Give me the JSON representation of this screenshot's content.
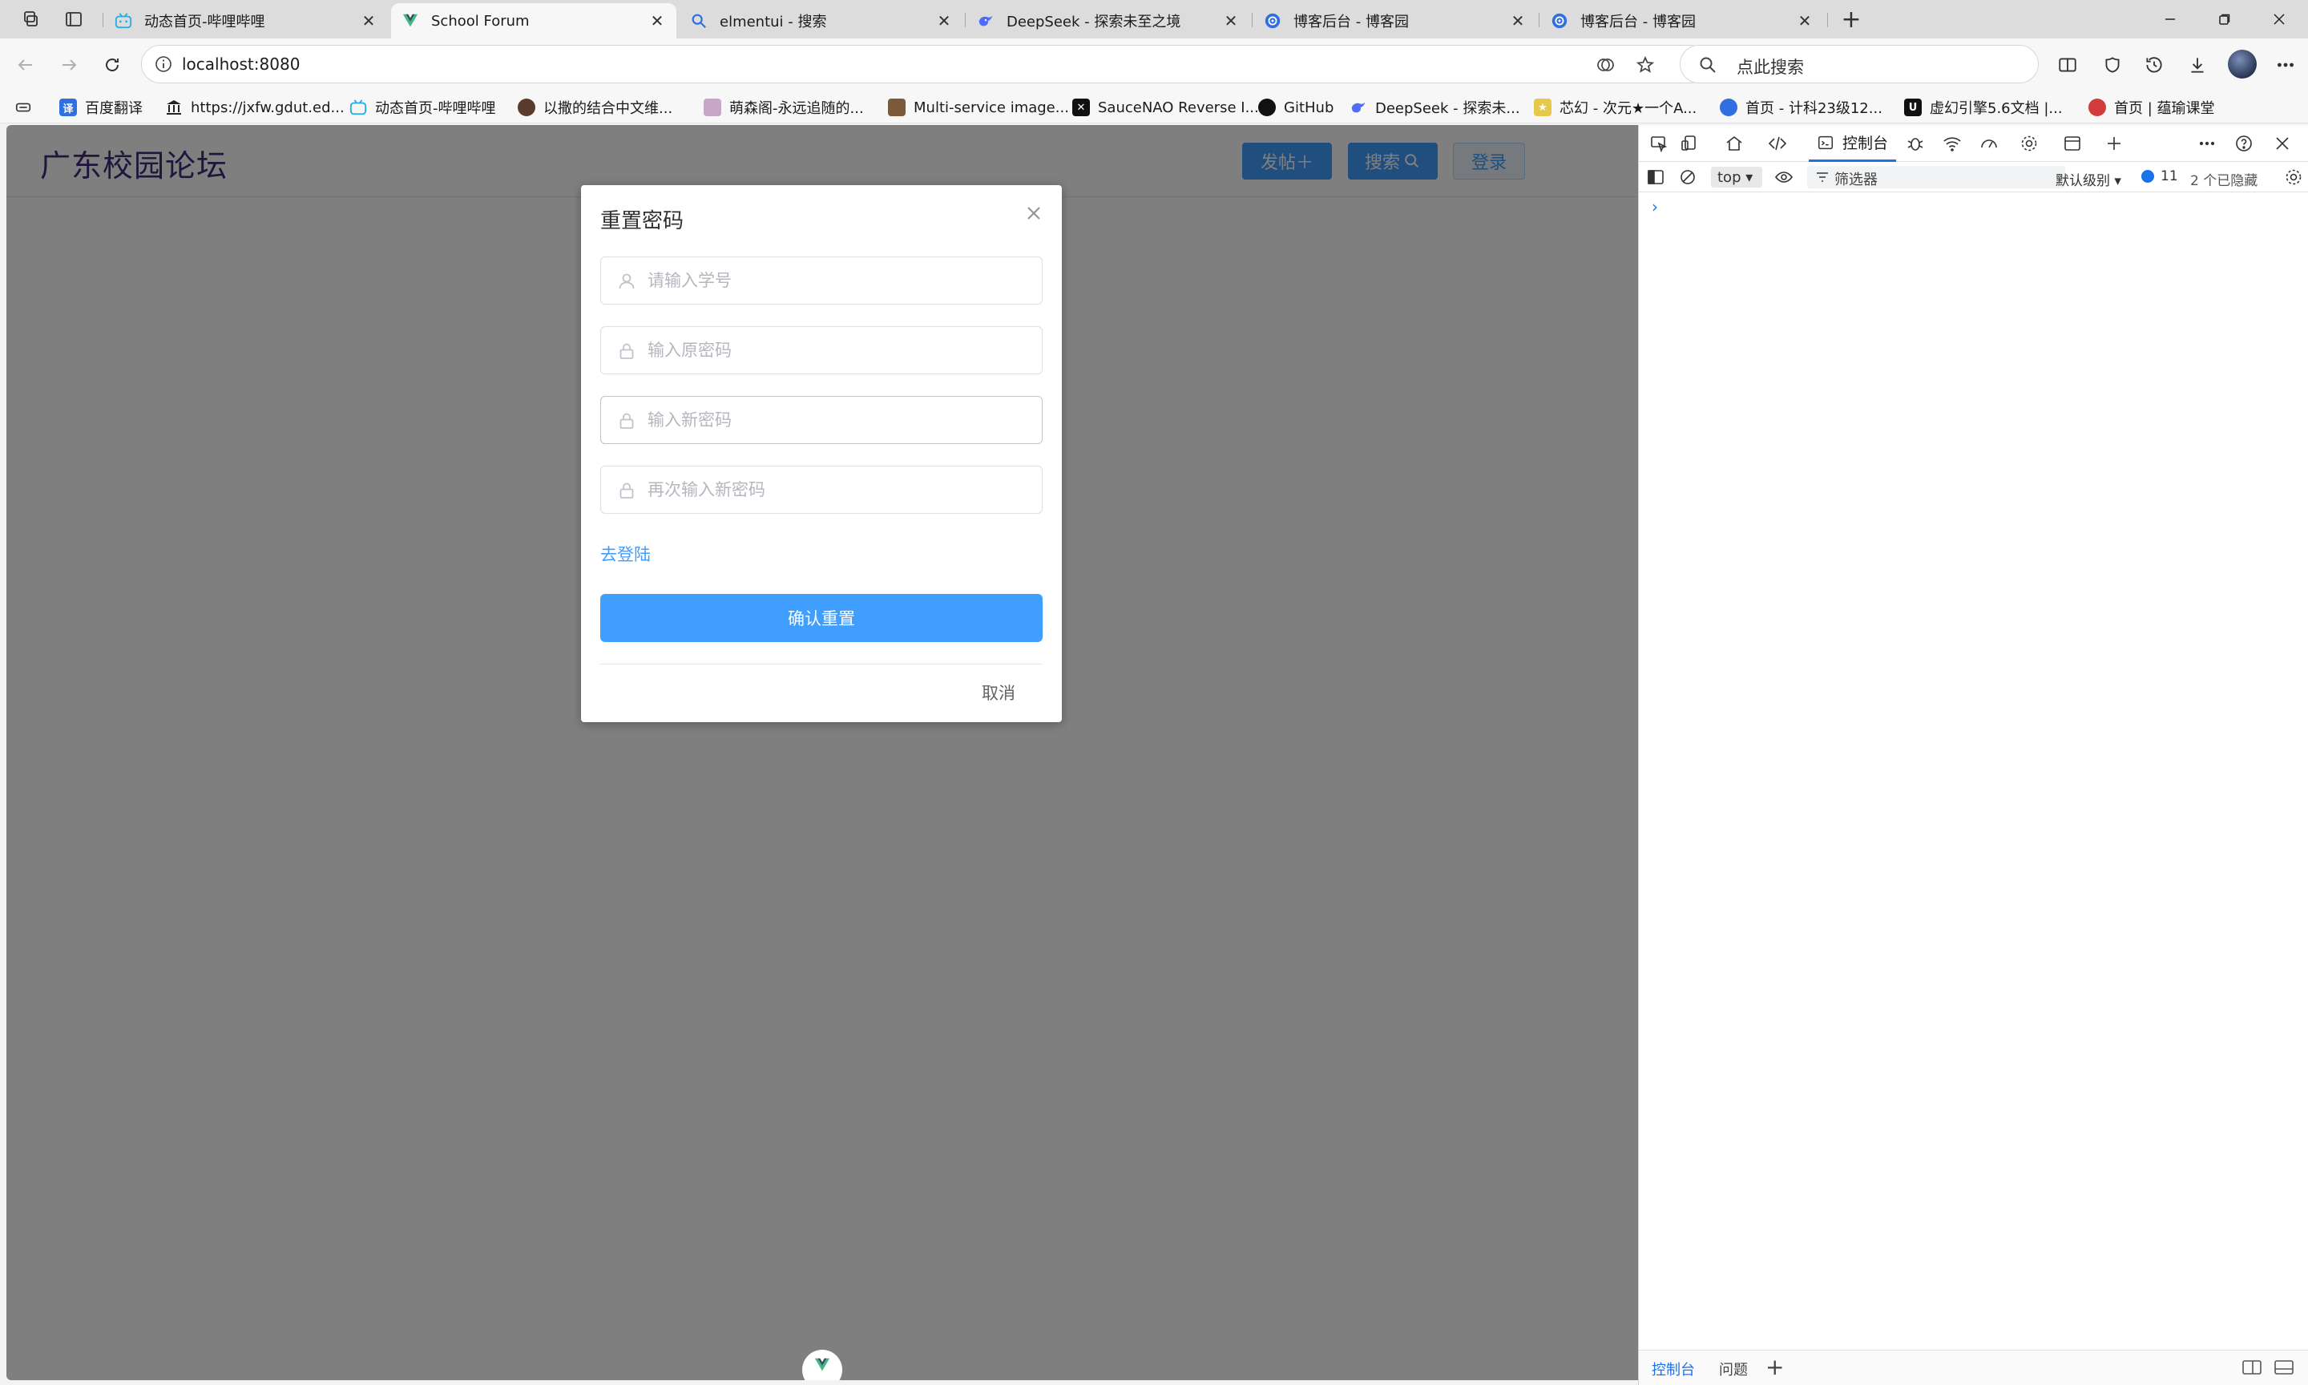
{
  "browser": {
    "tabs": [
      {
        "title": "动态首页-哔哩哔哩",
        "icon": "bilibili-icon",
        "active": false
      },
      {
        "title": "School Forum",
        "icon": "vue-icon",
        "active": true
      },
      {
        "title": "elmentui - 搜索",
        "icon": "search-icon",
        "active": false
      },
      {
        "title": "DeepSeek - 探索未至之境",
        "icon": "deepseek-icon",
        "active": false
      },
      {
        "title": "博客后台 - 博客园",
        "icon": "cnblogs-icon",
        "active": false
      },
      {
        "title": "博客后台 - 博客园",
        "icon": "cnblogs-icon",
        "active": false
      }
    ],
    "close_glyph": "✕",
    "new_tab_glyph": "+",
    "address": "localhost:8080",
    "search_placeholder": "点此搜索",
    "bookmarks": [
      {
        "label": "百度翻译",
        "icon": "baidu-translate-icon",
        "color": "#2f6fe0"
      },
      {
        "label": "https://jxfw.gdut.ed...",
        "icon": "institution-icon",
        "color": "#222222"
      },
      {
        "label": "动态首页-哔哩哔哩",
        "icon": "bilibili-icon",
        "color": "#23ade5"
      },
      {
        "label": "以撒的结合中文维...",
        "icon": "isaac-icon",
        "color": "#5a3b2e"
      },
      {
        "label": "萌森阁-永远追随的...",
        "icon": "cat-icon",
        "color": "#b08ab0"
      },
      {
        "label": "Multi-service image...",
        "icon": "image-search-icon",
        "color": "#7a5a3a"
      },
      {
        "label": "SauceNAO Reverse I...",
        "icon": "saucenao-icon",
        "color": "#111111"
      },
      {
        "label": "GitHub",
        "icon": "github-icon",
        "color": "#111111"
      },
      {
        "label": "DeepSeek - 探索未...",
        "icon": "deepseek-icon",
        "color": "#4d6bfe"
      },
      {
        "label": "芯幻 - 次元★一个A...",
        "icon": "star-icon",
        "color": "#e0c040"
      },
      {
        "label": "首页 - 计科23级12...",
        "icon": "cnblogs-icon",
        "color": "#2f6fe0"
      },
      {
        "label": "虚幻引擎5.6文档 |...",
        "icon": "unreal-icon",
        "color": "#111111"
      },
      {
        "label": "首页 | 蕴瑜课堂",
        "icon": "class-icon",
        "color": "#d23c3c"
      }
    ]
  },
  "app": {
    "brand": "广东校园论坛",
    "post_button": "发帖＋",
    "search_button": "搜索",
    "login_button": "登录",
    "accent": "#409eff"
  },
  "dialog": {
    "title": "重置密码",
    "fields": [
      {
        "placeholder": "请输入学号",
        "icon": "user-icon"
      },
      {
        "placeholder": "输入原密码",
        "icon": "lock-icon"
      },
      {
        "placeholder": "输入新密码",
        "icon": "lock-icon"
      },
      {
        "placeholder": "再次输入新密码",
        "icon": "lock-icon"
      }
    ],
    "login_link": "去登陆",
    "confirm_button": "确认重置",
    "cancel_button": "取消"
  },
  "devtools": {
    "active_tab": "控制台",
    "context": "top ▾",
    "filter_placeholder": "筛选器",
    "level": "默认级别 ▾",
    "message_count": "11",
    "hidden": "2 个已隐藏",
    "prompt": "›",
    "drawer_tabs": [
      "控制台",
      "问题"
    ],
    "drawer_add": "+"
  }
}
